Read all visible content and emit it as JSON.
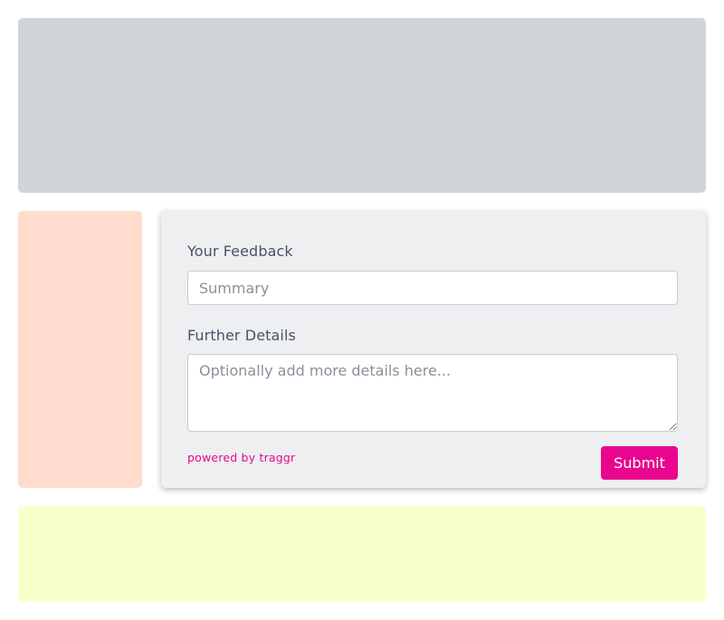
{
  "colors": {
    "top_block": "#d1d4d9",
    "side_block": "#ffdccd",
    "bottom_block": "#f9ffca",
    "card_background": "#eeeff1",
    "accent": "#e8068e",
    "label_text": "#4a5365"
  },
  "feedback_form": {
    "feedback_label": "Your Feedback",
    "summary_placeholder": "Summary",
    "summary_value": "",
    "details_label": "Further Details",
    "details_placeholder": "Optionally add more details here...",
    "details_value": "",
    "powered_by": "powered by traggr",
    "submit_label": "Submit"
  }
}
